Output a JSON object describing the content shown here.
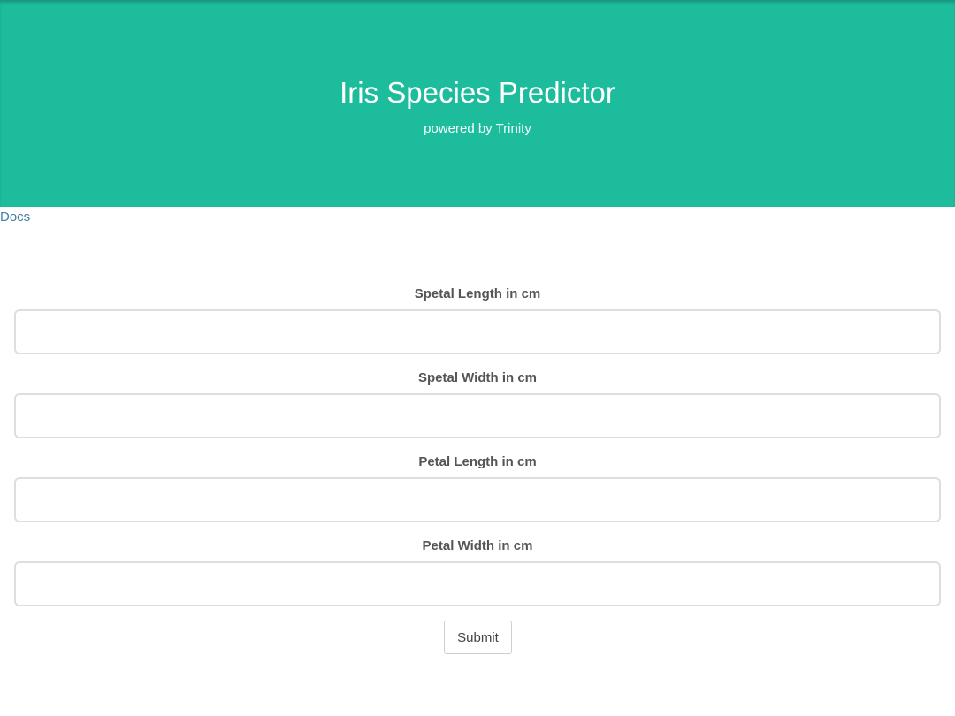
{
  "header": {
    "title": "Iris Species Predictor",
    "subtitle": "powered by Trinity",
    "background_color": "#1dbc9c"
  },
  "nav": {
    "docs_label": "Docs",
    "link_color": "#3f7fa6"
  },
  "form": {
    "fields": [
      {
        "label": "Spetal Length in cm",
        "value": "",
        "placeholder": ""
      },
      {
        "label": "Spetal Width in cm",
        "value": "",
        "placeholder": ""
      },
      {
        "label": "Petal Length in cm",
        "value": "",
        "placeholder": ""
      },
      {
        "label": "Petal Width in cm",
        "value": "",
        "placeholder": ""
      }
    ],
    "submit_label": "Submit"
  }
}
